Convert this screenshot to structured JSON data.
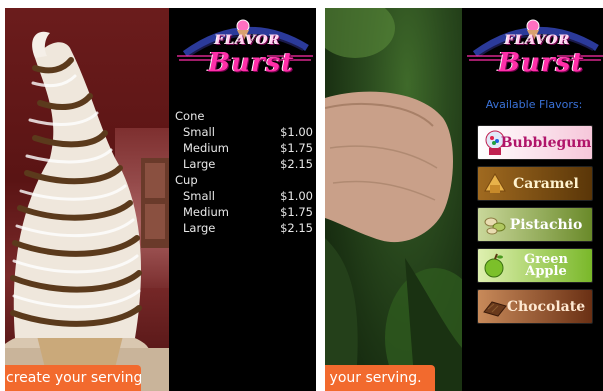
{
  "brand": {
    "line1": "FLAVOR",
    "line2": "Burst"
  },
  "menu": {
    "categories": [
      {
        "name": "Cone",
        "items": [
          {
            "size": "Small",
            "price": "$1.00"
          },
          {
            "size": "Medium",
            "price": "$1.75"
          },
          {
            "size": "Large",
            "price": "$2.15"
          }
        ]
      },
      {
        "name": "Cup",
        "items": [
          {
            "size": "Small",
            "price": "$1.00"
          },
          {
            "size": "Medium",
            "price": "$1.75"
          },
          {
            "size": "Large",
            "price": "$2.15"
          }
        ]
      }
    ]
  },
  "flavors": {
    "heading": "Available Flavors:",
    "items": [
      {
        "label": "Bubblegum",
        "icon": "gumball-icon",
        "bg": "#f6c7da",
        "fg": "#b0146a"
      },
      {
        "label": "Caramel",
        "icon": "caramel-icon",
        "bg": "#6a4410",
        "fg": "#fff3cf"
      },
      {
        "label": "Pistachio",
        "icon": "pistachio-icon",
        "bg": "#7fa23a",
        "fg": "#f6ffe0"
      },
      {
        "label": "Green Apple",
        "icon": "apple-icon",
        "bg": "#8cc63a",
        "fg": "#f4ffe6"
      },
      {
        "label": "Chocolate",
        "icon": "chocolate-icon",
        "bg": "#7a3f1c",
        "fg": "#ffe9d2"
      }
    ]
  },
  "toast": {
    "left": "create your serving.",
    "right": "te your serving."
  }
}
